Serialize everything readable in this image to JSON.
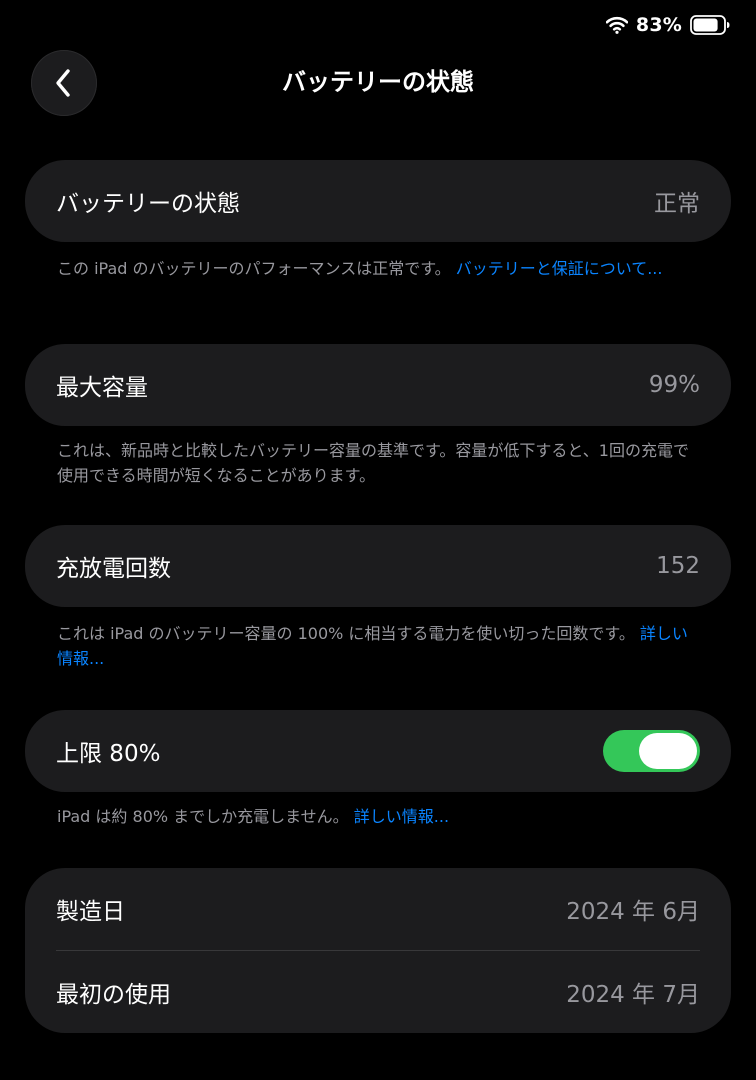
{
  "status_bar": {
    "battery_percent": "83%",
    "battery_level": 0.83
  },
  "header": {
    "title": "バッテリーの状態"
  },
  "battery_health": {
    "label": "バッテリーの状態",
    "value": "正常",
    "footnote_text": "この iPad のバッテリーのパフォーマンスは正常です。",
    "footnote_link": "バッテリーと保証について..."
  },
  "max_capacity": {
    "label": "最大容量",
    "value": "99%",
    "footnote_text": "これは、新品時と比較したバッテリー容量の基準です。容量が低下すると、1回の充電で使用できる時間が短くなることがあります。"
  },
  "cycle_count": {
    "label": "充放電回数",
    "value": "152",
    "footnote_text": "これは iPad のバッテリー容量の 100% に相当する電力を使い切った回数です。",
    "footnote_link": "詳しい情報..."
  },
  "limit": {
    "label": "上限 80%",
    "enabled": true,
    "footnote_text": "iPad は約 80% までしか充電しません。",
    "footnote_link": "詳しい情報..."
  },
  "dates": {
    "manufacture_label": "製造日",
    "manufacture_value": "2024 年 6月",
    "first_use_label": "最初の使用",
    "first_use_value": "2024 年 7月"
  },
  "colors": {
    "background": "#000000",
    "card": "#1c1c1e",
    "secondary_text": "#98989e",
    "link": "#0a84ff",
    "toggle_on": "#34c759"
  },
  "icons": {
    "status": [
      "wifi-icon",
      "battery-icon"
    ],
    "navigation": "chevron-left-icon"
  }
}
